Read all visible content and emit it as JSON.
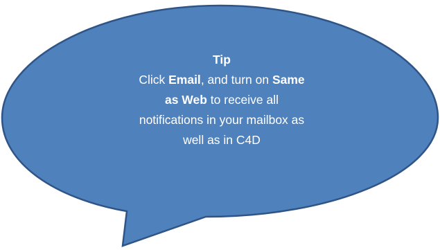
{
  "callout": {
    "fill_color": "#4f81bd",
    "stroke_color": "#2f5486",
    "title": "Tip",
    "body": {
      "part1": "Click ",
      "bold1": "Email",
      "part2": ", and turn on ",
      "bold2": "Same as Web",
      "part3": " to receive all notifications in your mailbox as well as in C4D"
    }
  }
}
